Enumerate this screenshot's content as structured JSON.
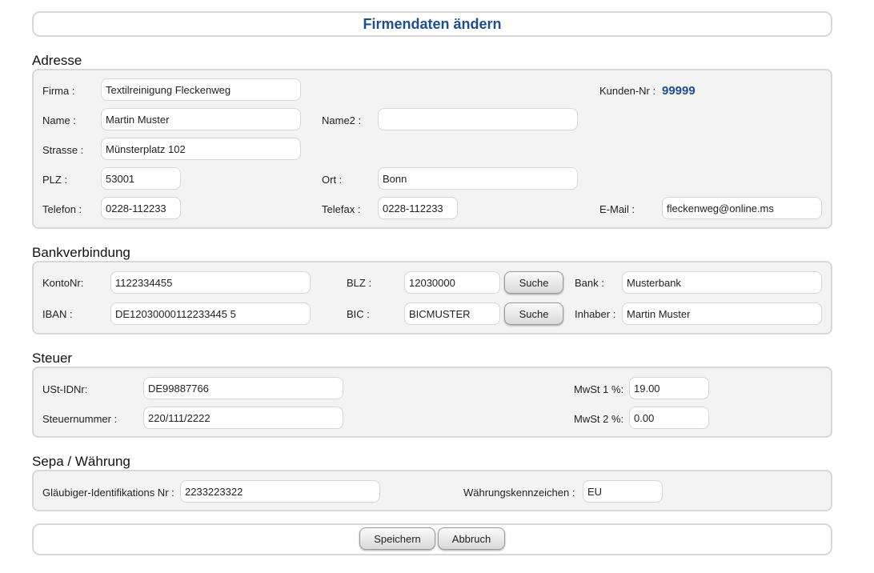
{
  "header": {
    "title": "Firmendaten ändern"
  },
  "adresse": {
    "title": "Adresse",
    "firma_label": "Firma :",
    "firma_value": "Textilreinigung Fleckenweg",
    "kundennr_label": "Kunden-Nr :",
    "kundennr_value": "99999",
    "name_label": "Name :",
    "name_value": "Martin Muster",
    "name2_label": "Name2 :",
    "name2_value": "",
    "strasse_label": "Strasse :",
    "strasse_value": "Münsterplatz 102",
    "plz_label": "PLZ :",
    "plz_value": "53001",
    "ort_label": "Ort :",
    "ort_value": "Bonn",
    "telefon_label": "Telefon :",
    "telefon_value": "0228-112233",
    "telefax_label": "Telefax :",
    "telefax_value": "0228-112233",
    "email_label": "E-Mail :",
    "email_value": "fleckenweg@online.ms"
  },
  "bank": {
    "title": "Bankverbindung",
    "konto_label": "KontoNr:",
    "konto_value": "1122334455",
    "blz_label": "BLZ :",
    "blz_value": "12030000",
    "bank_label": "Bank :",
    "bank_value": "Musterbank",
    "iban_label": "IBAN :",
    "iban_value": "DE12030000112233445 5",
    "bic_label": "BIC :",
    "bic_value": "BICMUSTER",
    "inhaber_label": "Inhaber :",
    "inhaber_value": "Martin Muster",
    "suche_label": "Suche"
  },
  "steuer": {
    "title": "Steuer",
    "ustid_label": "USt-IDNr:",
    "ustid_value": "DE99887766",
    "steuernr_label": "Steuernummer :",
    "steuernr_value": "220/111/2222",
    "mwst1_label": "MwSt 1 %:",
    "mwst1_value": "19.00",
    "mwst2_label": "MwSt 2 %:",
    "mwst2_value": "0.00"
  },
  "sepa": {
    "title": "Sepa / Währung",
    "glaeubiger_label": "Gläubiger-Identifikations Nr :",
    "glaeubiger_value": "2233223322",
    "waehrung_label": "Währungskennzeichen :",
    "waehrung_value": "EU"
  },
  "footer": {
    "save_label": "Speichern",
    "cancel_label": "Abbruch"
  },
  "colors": {
    "accent": "#1f4e8c",
    "panel_bg": "#f3f3f3",
    "border": "#d8d8d8"
  }
}
